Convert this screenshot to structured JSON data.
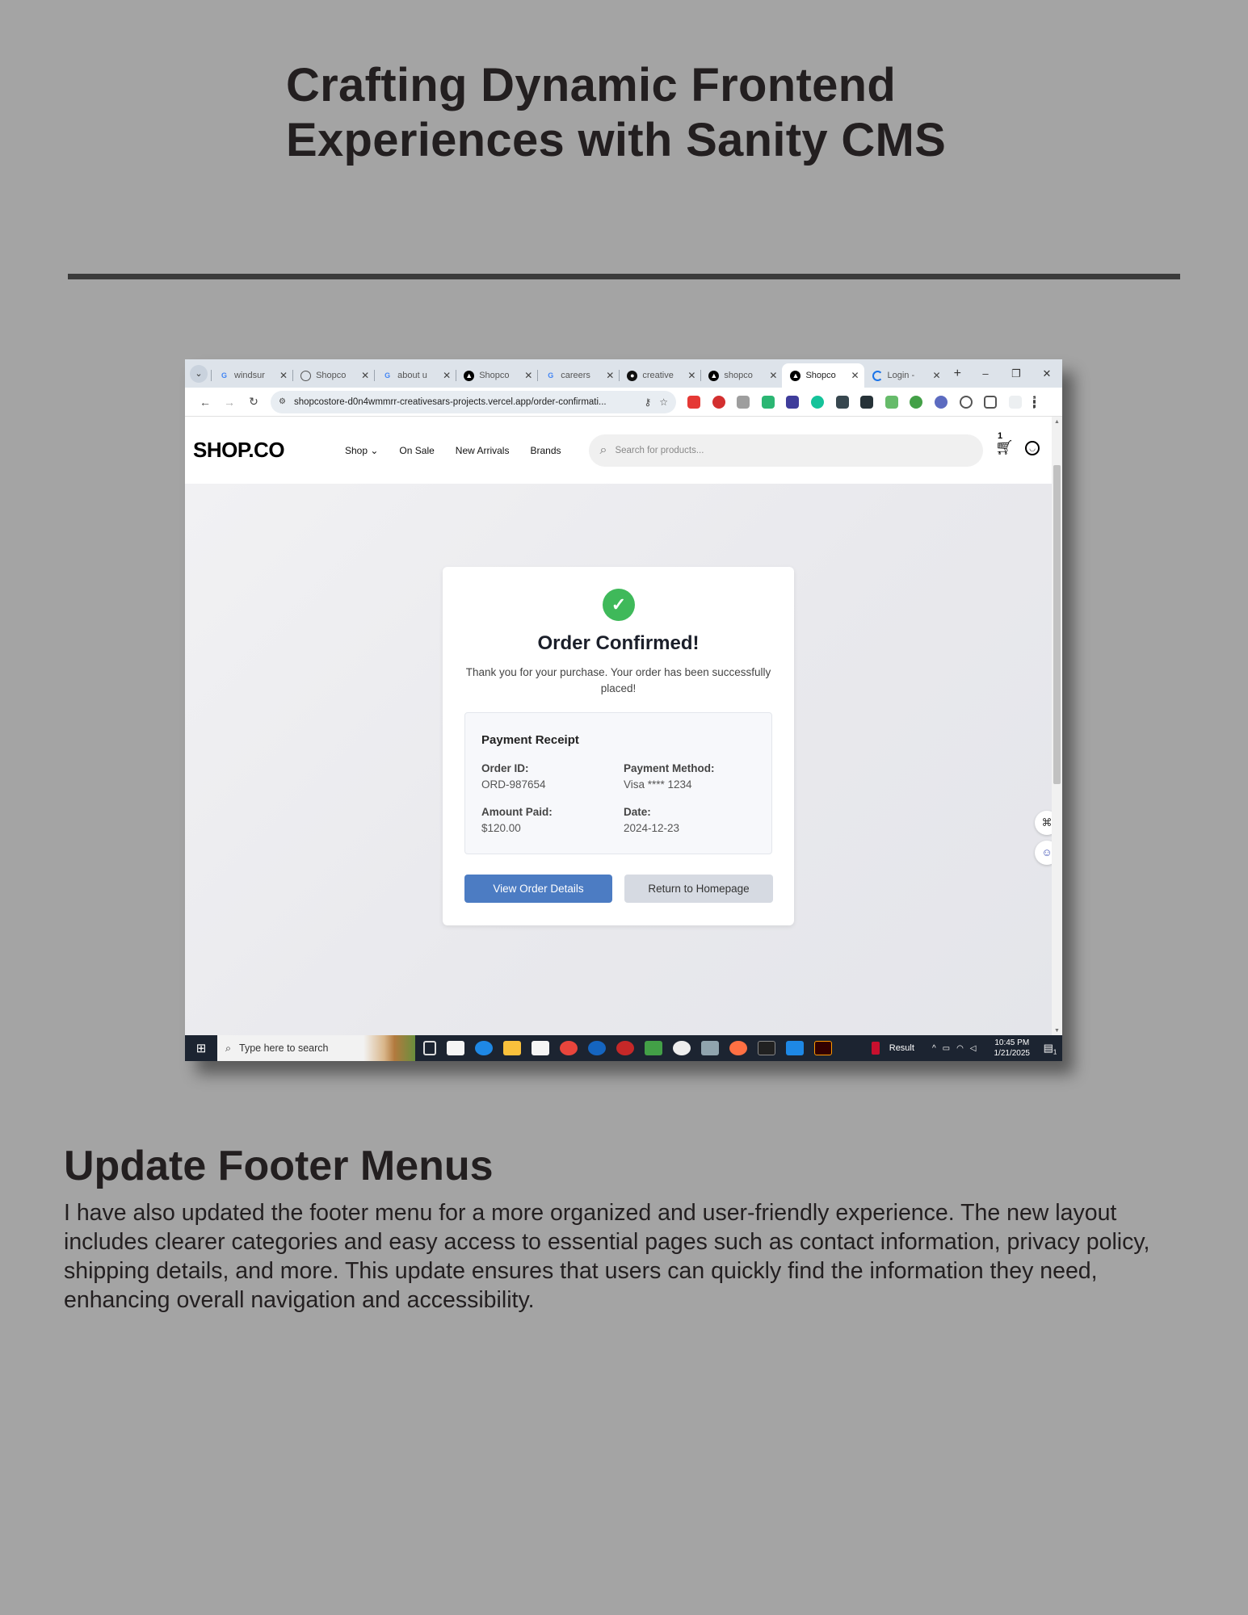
{
  "doc": {
    "title_line1": "Crafting Dynamic Frontend",
    "title_line2": "Experiences with Sanity CMS",
    "section_title": "Update Footer Menus",
    "section_body": "I have also updated the footer menu for a more organized and user-friendly experience. The new layout includes clearer categories and easy access to essential pages such as contact information, privacy policy, shipping details, and more. This update ensures that users can quickly find the information they need, enhancing overall navigation and accessibility."
  },
  "browser": {
    "tabs": [
      {
        "label": "windsur",
        "favicon": "google-icon",
        "active": false
      },
      {
        "label": "Shopco",
        "favicon": "globe-icon",
        "active": false
      },
      {
        "label": "about u",
        "favicon": "google-icon",
        "active": false
      },
      {
        "label": "Shopco",
        "favicon": "vercel-icon",
        "active": false
      },
      {
        "label": "careers",
        "favicon": "google-icon",
        "active": false
      },
      {
        "label": "creative",
        "favicon": "github-icon",
        "active": false
      },
      {
        "label": "shopco",
        "favicon": "vercel-icon",
        "active": false
      },
      {
        "label": "Shopco",
        "favicon": "vercel-icon",
        "active": true
      },
      {
        "label": "Login -",
        "favicon": "loading-icon",
        "active": false
      }
    ],
    "url": "shopcostore-d0n4wmmrr-creativesars-projects.vercel.app/order-confirmati..."
  },
  "site": {
    "logo": "SHOP.CO",
    "nav": {
      "shop": "Shop ⌄",
      "on_sale": "On Sale",
      "new_arrivals": "New Arrivals",
      "brands": "Brands"
    },
    "search_placeholder": "Search for products...",
    "cart_count": "1"
  },
  "order": {
    "title": "Order Confirmed!",
    "message": "Thank you for your purchase. Your order has been successfully placed!",
    "receipt_title": "Payment Receipt",
    "order_id_label": "Order ID:",
    "order_id": "ORD-987654",
    "payment_method_label": "Payment Method:",
    "payment_method": "Visa **** 1234",
    "amount_label": "Amount Paid:",
    "amount": "$120.00",
    "date_label": "Date:",
    "date": "2024-12-23",
    "primary_button": "View Order Details",
    "secondary_button": "Return to Homepage",
    "success_color": "#3fb95a",
    "primary_color": "#4c7cc3"
  },
  "taskbar": {
    "search_placeholder": "Type here to search",
    "tray_label": "Result",
    "time": "10:45 PM",
    "date": "1/21/2025",
    "notification_count": "1"
  }
}
